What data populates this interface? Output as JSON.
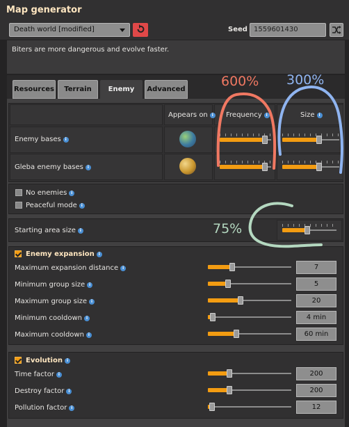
{
  "window": {
    "title": "Map generator"
  },
  "preset": {
    "selected": "Death world [modified]",
    "seed_label": "Seed",
    "seed_value": "1559601430"
  },
  "description": "Biters are more dangerous and evolve faster.",
  "tabs": [
    {
      "label": "Resources",
      "active": false
    },
    {
      "label": "Terrain",
      "active": false
    },
    {
      "label": "Enemy",
      "active": true
    },
    {
      "label": "Advanced",
      "active": false
    }
  ],
  "enemy_table": {
    "headers": {
      "appears_on": "Appears on",
      "frequency": "Frequency",
      "size": "Size"
    },
    "rows": [
      {
        "label": "Enemy bases",
        "planet": "nauvis",
        "frequency": 0.92,
        "size": 0.66
      },
      {
        "label": "Gleba enemy bases",
        "planet": "gleba",
        "frequency": 0.92,
        "size": 0.66
      }
    ]
  },
  "toggles": {
    "no_enemies": "No enemies",
    "peaceful_mode": "Peaceful mode"
  },
  "starting_area": {
    "label": "Starting area size",
    "value": 0.45
  },
  "expansion": {
    "title": "Enemy expansion",
    "enabled": true,
    "rows": [
      {
        "label": "Maximum expansion distance",
        "value": "7",
        "level": 0.28
      },
      {
        "label": "Minimum group size",
        "value": "5",
        "level": 0.22
      },
      {
        "label": "Maximum group size",
        "value": "20",
        "level": 0.38
      },
      {
        "label": "Minimum cooldown",
        "value": "4 min",
        "level": 0.03
      },
      {
        "label": "Maximum cooldown",
        "value": "60 min",
        "level": 0.33
      }
    ]
  },
  "evolution": {
    "title": "Evolution",
    "enabled": true,
    "rows": [
      {
        "label": "Time factor",
        "value": "200",
        "level": 0.24
      },
      {
        "label": "Destroy factor",
        "value": "200",
        "level": 0.24
      },
      {
        "label": "Pollution factor",
        "value": "12",
        "level": 0.02
      }
    ]
  },
  "annotations": {
    "frequency": "600%",
    "size": "300%",
    "starting_area": "75%"
  },
  "colors": {
    "accent": "#f39c12",
    "reset": "#e04848",
    "info": "#4a8fd4",
    "anno_red": "#f07862",
    "anno_blue": "#8fb4f0",
    "anno_green": "#b4d8c0"
  }
}
